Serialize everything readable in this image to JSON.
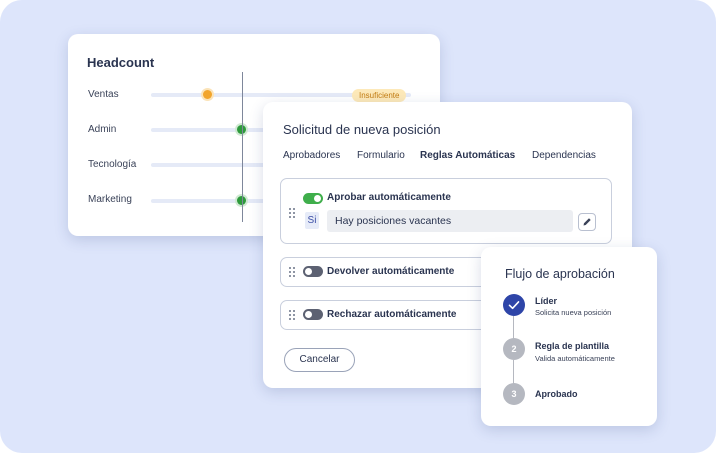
{
  "headcount": {
    "title": "Headcount",
    "rows": [
      {
        "label": "Ventas",
        "status": "orange",
        "badge": "Insuficiente"
      },
      {
        "label": "Admin",
        "status": "green"
      },
      {
        "label": "Tecnología",
        "status": "green"
      },
      {
        "label": "Marketing",
        "status": "green"
      }
    ]
  },
  "solicitud": {
    "title": "Solicitud de nueva posición",
    "tabs": [
      "Aprobadores",
      "Formulario",
      "Reglas Automáticas",
      "Dependencias"
    ],
    "active_tab": "Reglas Automáticas",
    "rules": [
      {
        "label": "Aprobar automáticamente",
        "enabled": true,
        "condition_prefix": "Si",
        "condition_value": "Hay posiciones vacantes"
      },
      {
        "label": "Devolver automáticamente",
        "enabled": false
      },
      {
        "label": "Rechazar automáticamente",
        "enabled": false
      }
    ],
    "cancel_label": "Cancelar"
  },
  "flujo": {
    "title": "Flujo de aprobación",
    "steps": [
      {
        "number": "",
        "state": "done",
        "title": "Líder",
        "subtitle": "Solicita nueva posición"
      },
      {
        "number": "2",
        "state": "pending",
        "title": "Regla de plantilla",
        "subtitle": "Valida automáticamente"
      },
      {
        "number": "3",
        "state": "pending",
        "title": "Aprobado",
        "subtitle": ""
      }
    ]
  },
  "colors": {
    "background": "#dde5fb",
    "accent_blue": "#2e45a8",
    "toggle_on": "#3fae4b",
    "status_warning": "#f2a52c",
    "status_ok": "#2e9a3c"
  }
}
